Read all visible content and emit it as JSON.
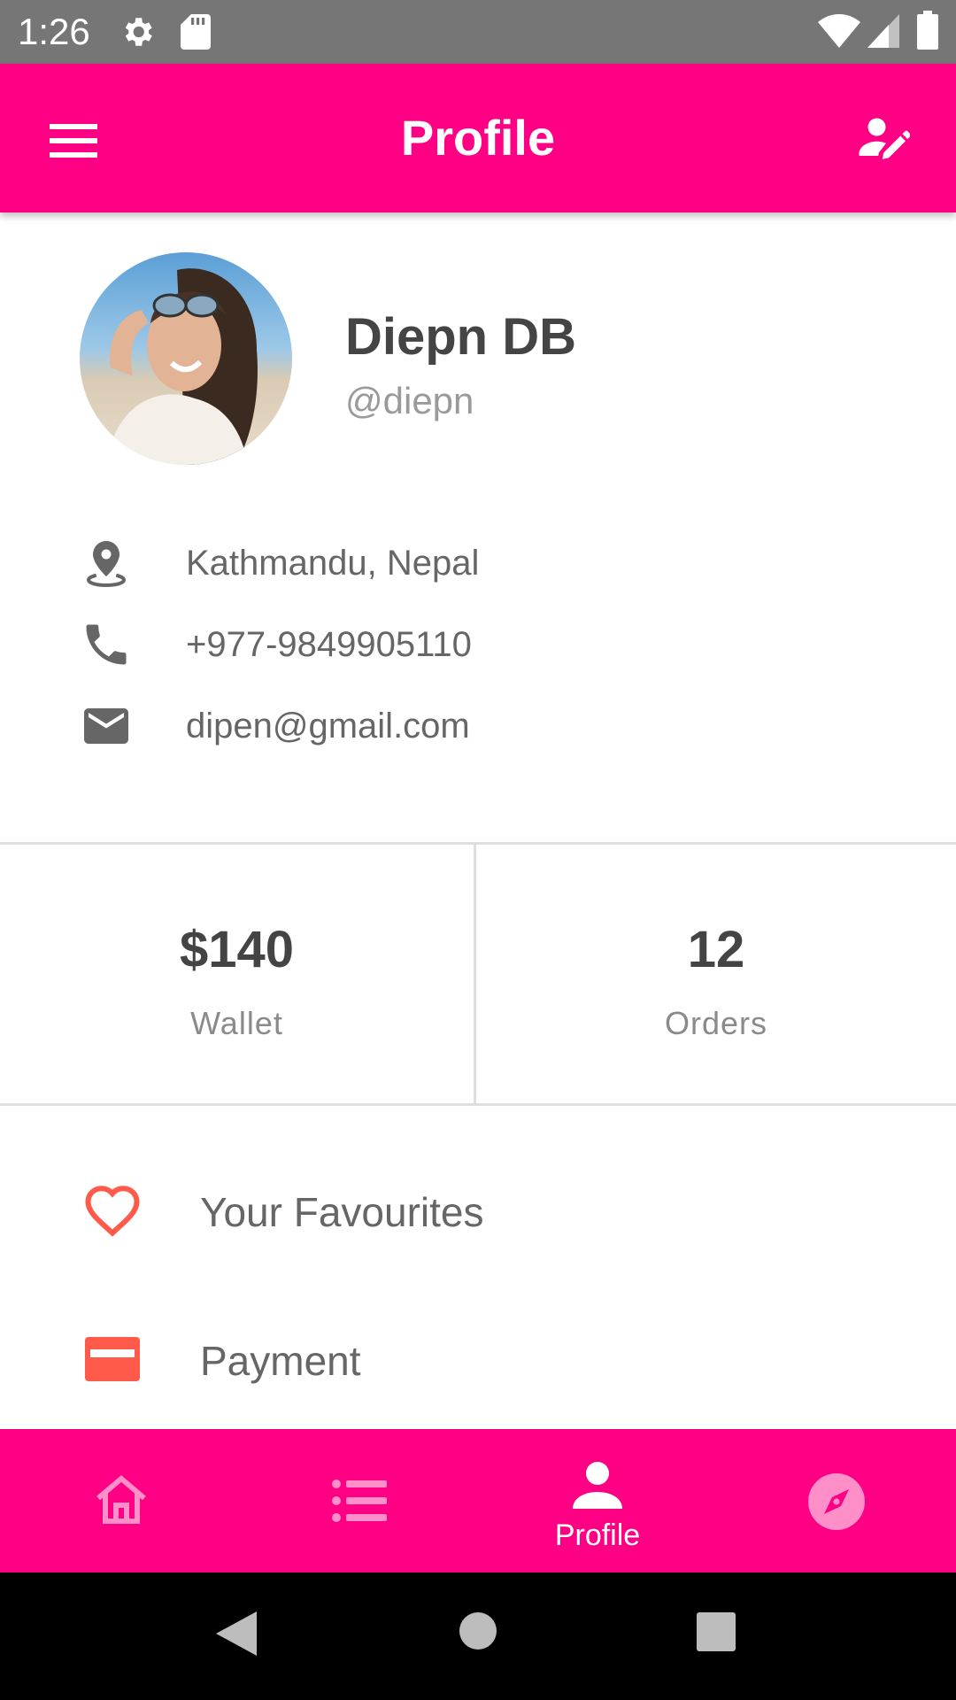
{
  "status_bar": {
    "time": "1:26",
    "icons": [
      "settings-icon",
      "sd-card-icon",
      "wifi-icon",
      "signal-icon",
      "battery-icon"
    ]
  },
  "app_bar": {
    "title": "Profile",
    "left_icon": "menu-icon",
    "right_icon": "edit-profile-icon",
    "background": "#ff0084"
  },
  "profile": {
    "name": "Diepn DB",
    "handle": "@diepn",
    "avatar": "profile-photo"
  },
  "contact": [
    {
      "icon": "location-pin-icon",
      "text": "Kathmandu, Nepal"
    },
    {
      "icon": "phone-icon",
      "text": "+977-9849905110"
    },
    {
      "icon": "email-icon",
      "text": "dipen@gmail.com"
    }
  ],
  "stats": {
    "wallet": {
      "value": "$140",
      "label": "Wallet"
    },
    "orders": {
      "value": "12",
      "label": "Orders"
    }
  },
  "menu": [
    {
      "icon": "heart-icon",
      "label": "Your Favourites"
    },
    {
      "icon": "credit-card-icon",
      "label": "Payment"
    }
  ],
  "bottom_nav": {
    "items": [
      {
        "icon": "home-icon",
        "label": ""
      },
      {
        "icon": "list-icon",
        "label": ""
      },
      {
        "icon": "person-icon",
        "label": "Profile"
      },
      {
        "icon": "compass-icon",
        "label": ""
      }
    ],
    "active_index": 2
  },
  "colors": {
    "accent": "#ff0084",
    "icon_accent": "#ff5a4a",
    "text_primary": "#444444",
    "text_secondary": "#666666",
    "status_bar": "#767676"
  }
}
